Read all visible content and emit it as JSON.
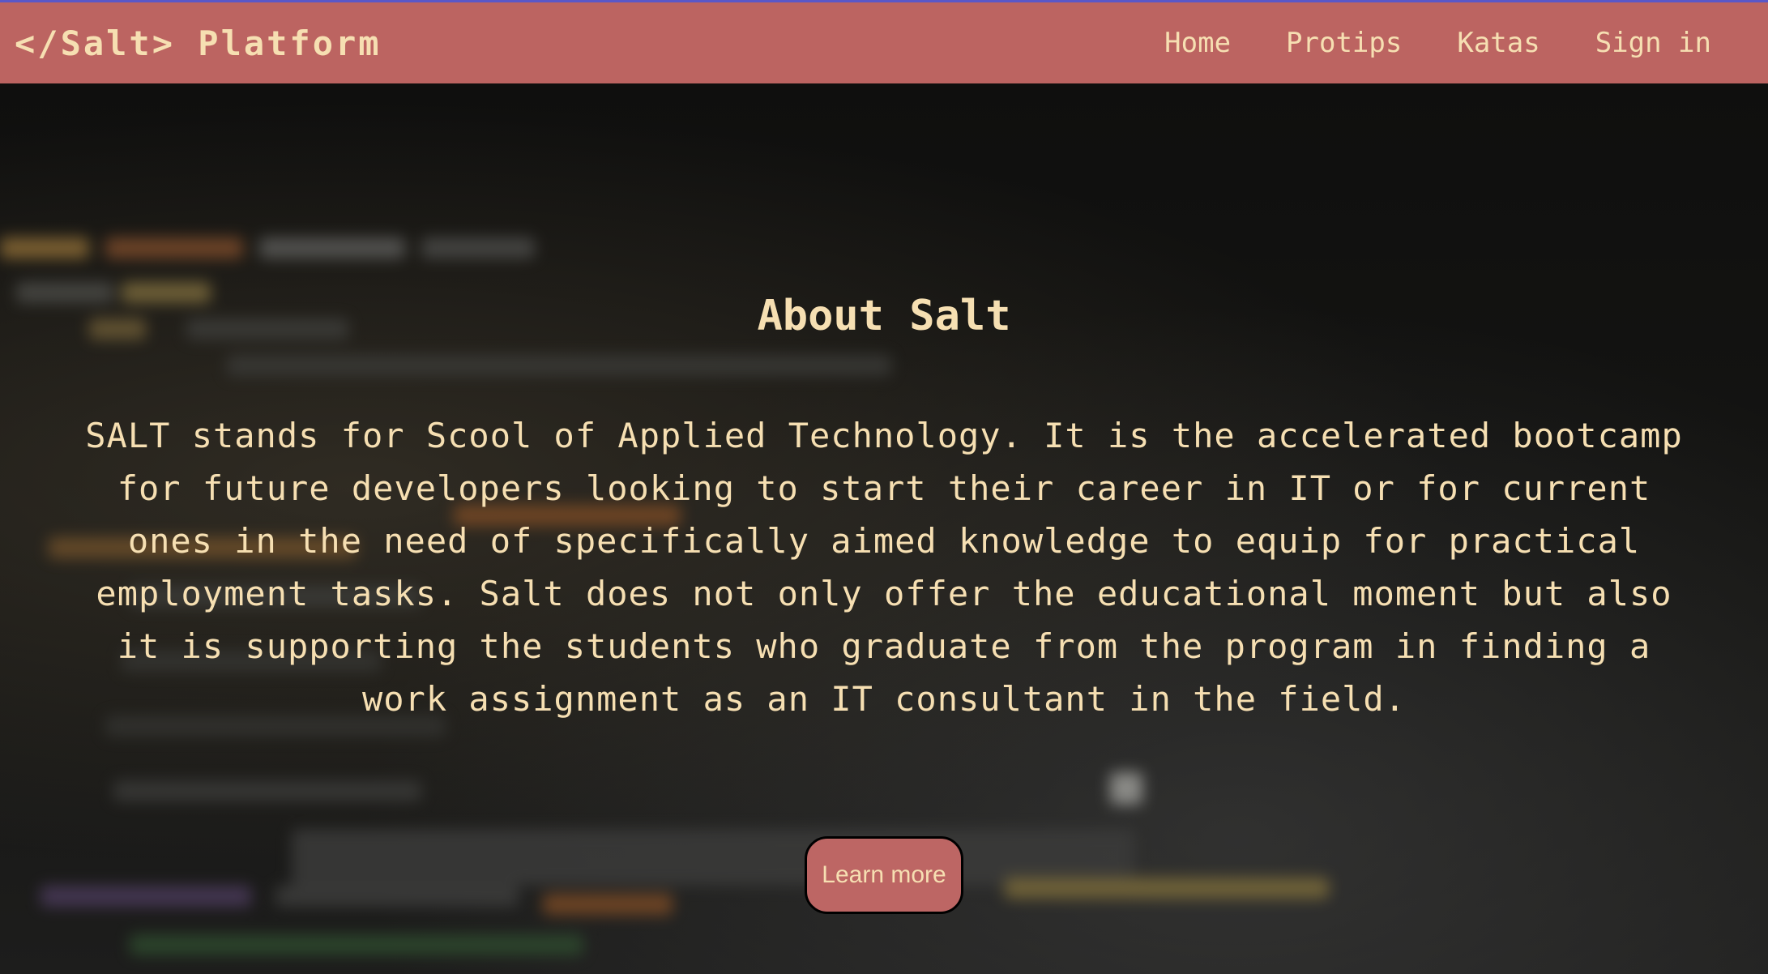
{
  "navbar": {
    "brand": "</Salt> Platform",
    "links": [
      {
        "label": "Home"
      },
      {
        "label": "Protips"
      },
      {
        "label": "Katas"
      },
      {
        "label": "Sign in"
      }
    ]
  },
  "hero": {
    "title": "About Salt",
    "description": "SALT stands for Scool of Applied Technology. It is the accelerated bootcamp for future developers looking to start their career in IT or for current ones in the need of specifically aimed knowledge to equip for practical employment tasks. Salt does not only offer the educational moment but also it is supporting the students who graduate from the program in finding a work assignment as an IT consultant in the field.",
    "button_label": "Learn more"
  },
  "colors": {
    "navbar": "#bc6461",
    "text": "#f6dfb2",
    "button": "#bd6664"
  }
}
